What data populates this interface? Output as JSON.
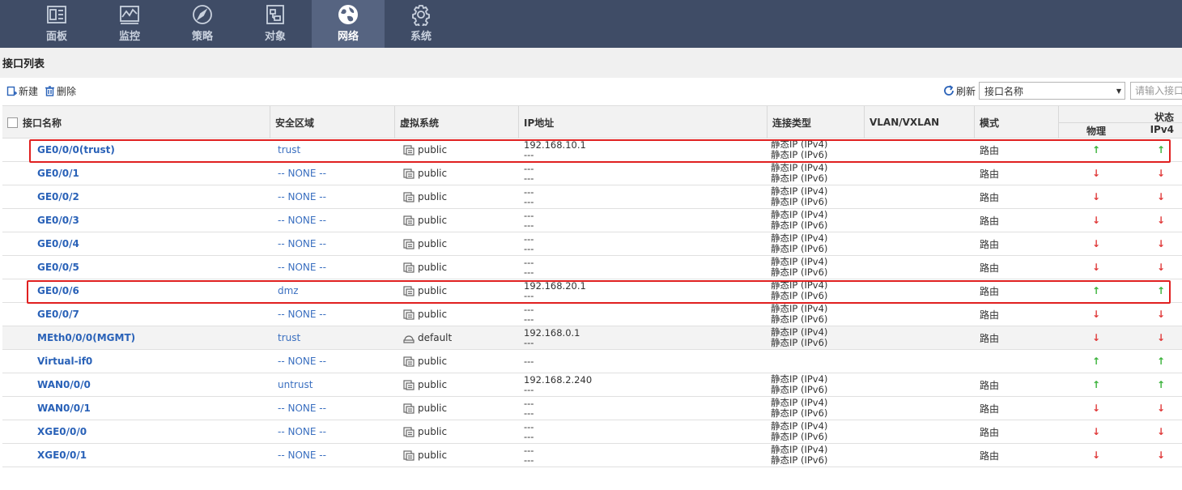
{
  "nav": [
    {
      "label": "面板",
      "icon": "dashboard-icon",
      "active": false
    },
    {
      "label": "监控",
      "icon": "monitor-icon",
      "active": false
    },
    {
      "label": "策略",
      "icon": "compass-icon",
      "active": false
    },
    {
      "label": "对象",
      "icon": "object-icon",
      "active": false
    },
    {
      "label": "网络",
      "icon": "globe-icon",
      "active": true
    },
    {
      "label": "系统",
      "icon": "gear-icon",
      "active": false
    }
  ],
  "page_title": "接口列表",
  "toolbar": {
    "new_label": "新建",
    "delete_label": "删除",
    "refresh_label": "刷新",
    "filter_selected": "接口名称",
    "search_placeholder": "请输入接口"
  },
  "columns": {
    "name": "接口名称",
    "zone": "安全区域",
    "vsys": "虚拟系统",
    "ip": "IP地址",
    "conn_type": "连接类型",
    "vlan": "VLAN/VXLAN",
    "mode": "模式",
    "status": "状态",
    "physical": "物理",
    "ipv4": "IPv4"
  },
  "colors": {
    "accent_link": "#2a62b8",
    "up": "#3ab23a",
    "down": "#e03b3b",
    "highlight": "#e02020",
    "nav_bg": "#3f4c66"
  },
  "rows": [
    {
      "name": "GE0/0/0(trust)",
      "zone": "trust",
      "vsys": "public",
      "vsys_icon": "vsys-icon",
      "ip1": "192.168.10.1",
      "ip2": "---",
      "ct1": "静态IP (IPv4)",
      "ct2": "静态IP (IPv6)",
      "mode": "路由",
      "phy": "up",
      "v4": "up",
      "gray": false
    },
    {
      "name": "GE0/0/1",
      "zone": "-- NONE --",
      "vsys": "public",
      "vsys_icon": "vsys-icon",
      "ip1": "---",
      "ip2": "---",
      "ct1": "静态IP (IPv4)",
      "ct2": "静态IP (IPv6)",
      "mode": "路由",
      "phy": "down",
      "v4": "down",
      "gray": false
    },
    {
      "name": "GE0/0/2",
      "zone": "-- NONE --",
      "vsys": "public",
      "vsys_icon": "vsys-icon",
      "ip1": "---",
      "ip2": "---",
      "ct1": "静态IP (IPv4)",
      "ct2": "静态IP (IPv6)",
      "mode": "路由",
      "phy": "down",
      "v4": "down",
      "gray": false
    },
    {
      "name": "GE0/0/3",
      "zone": "-- NONE --",
      "vsys": "public",
      "vsys_icon": "vsys-icon",
      "ip1": "---",
      "ip2": "---",
      "ct1": "静态IP (IPv4)",
      "ct2": "静态IP (IPv6)",
      "mode": "路由",
      "phy": "down",
      "v4": "down",
      "gray": false
    },
    {
      "name": "GE0/0/4",
      "zone": "-- NONE --",
      "vsys": "public",
      "vsys_icon": "vsys-icon",
      "ip1": "---",
      "ip2": "---",
      "ct1": "静态IP (IPv4)",
      "ct2": "静态IP (IPv6)",
      "mode": "路由",
      "phy": "down",
      "v4": "down",
      "gray": false
    },
    {
      "name": "GE0/0/5",
      "zone": "-- NONE --",
      "vsys": "public",
      "vsys_icon": "vsys-icon",
      "ip1": "---",
      "ip2": "---",
      "ct1": "静态IP (IPv4)",
      "ct2": "静态IP (IPv6)",
      "mode": "路由",
      "phy": "down",
      "v4": "down",
      "gray": false
    },
    {
      "name": "GE0/0/6",
      "zone": "dmz",
      "vsys": "public",
      "vsys_icon": "vsys-icon",
      "ip1": "192.168.20.1",
      "ip2": "---",
      "ct1": "静态IP (IPv4)",
      "ct2": "静态IP (IPv6)",
      "mode": "路由",
      "phy": "up",
      "v4": "up",
      "gray": false
    },
    {
      "name": "GE0/0/7",
      "zone": "-- NONE --",
      "vsys": "public",
      "vsys_icon": "vsys-icon",
      "ip1": "---",
      "ip2": "---",
      "ct1": "静态IP (IPv4)",
      "ct2": "静态IP (IPv6)",
      "mode": "路由",
      "phy": "down",
      "v4": "down",
      "gray": false
    },
    {
      "name": "MEth0/0/0(MGMT)",
      "zone": "trust",
      "vsys": "default",
      "vsys_icon": "default-vsys-icon",
      "ip1": "192.168.0.1",
      "ip2": "---",
      "ct1": "静态IP (IPv4)",
      "ct2": "静态IP (IPv6)",
      "mode": "路由",
      "phy": "down",
      "v4": "down",
      "gray": true
    },
    {
      "name": "Virtual-if0",
      "zone": "-- NONE --",
      "vsys": "public",
      "vsys_icon": "vsys-icon",
      "ip1": "---",
      "ip2": "",
      "ct1": "",
      "ct2": "",
      "mode": "",
      "phy": "up",
      "v4": "up",
      "gray": false
    },
    {
      "name": "WAN0/0/0",
      "zone": "untrust",
      "vsys": "public",
      "vsys_icon": "vsys-icon",
      "ip1": "192.168.2.240",
      "ip2": "---",
      "ct1": "静态IP (IPv4)",
      "ct2": "静态IP (IPv6)",
      "mode": "路由",
      "phy": "up",
      "v4": "up",
      "gray": false
    },
    {
      "name": "WAN0/0/1",
      "zone": "-- NONE --",
      "vsys": "public",
      "vsys_icon": "vsys-icon",
      "ip1": "---",
      "ip2": "---",
      "ct1": "静态IP (IPv4)",
      "ct2": "静态IP (IPv6)",
      "mode": "路由",
      "phy": "down",
      "v4": "down",
      "gray": false
    },
    {
      "name": "XGE0/0/0",
      "zone": "-- NONE --",
      "vsys": "public",
      "vsys_icon": "vsys-icon",
      "ip1": "---",
      "ip2": "---",
      "ct1": "静态IP (IPv4)",
      "ct2": "静态IP (IPv6)",
      "mode": "路由",
      "phy": "down",
      "v4": "down",
      "gray": false
    },
    {
      "name": "XGE0/0/1",
      "zone": "-- NONE --",
      "vsys": "public",
      "vsys_icon": "vsys-icon",
      "ip1": "---",
      "ip2": "---",
      "ct1": "静态IP (IPv4)",
      "ct2": "静态IP (IPv6)",
      "mode": "路由",
      "phy": "down",
      "v4": "down",
      "gray": false
    }
  ]
}
